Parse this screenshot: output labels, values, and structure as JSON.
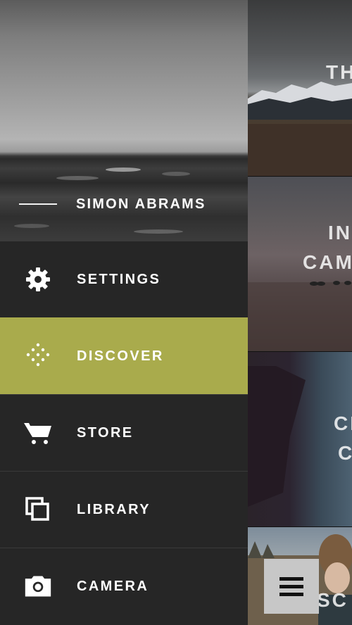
{
  "profile": {
    "name": "SIMON ABRAMS"
  },
  "menu": {
    "items": [
      {
        "label": "SETTINGS",
        "icon": "gear-icon"
      },
      {
        "label": "DISCOVER",
        "icon": "dots-icon",
        "active": true
      },
      {
        "label": "STORE",
        "icon": "cart-icon"
      },
      {
        "label": "LIBRARY",
        "icon": "library-icon"
      },
      {
        "label": "CAMERA",
        "icon": "camera-icon"
      }
    ]
  },
  "feed": {
    "cards": [
      {
        "title_lines": [
          "TH"
        ]
      },
      {
        "title_lines": [
          "IN",
          "CAM"
        ]
      },
      {
        "title_lines": [
          "CI",
          "C"
        ]
      },
      {
        "title_lines": [
          "SC"
        ]
      }
    ]
  },
  "colors": {
    "accent": "#a9ab4c",
    "drawer": "#262626",
    "divider": "#3a3a3a"
  },
  "menu_button": {
    "icon": "hamburger-icon"
  }
}
